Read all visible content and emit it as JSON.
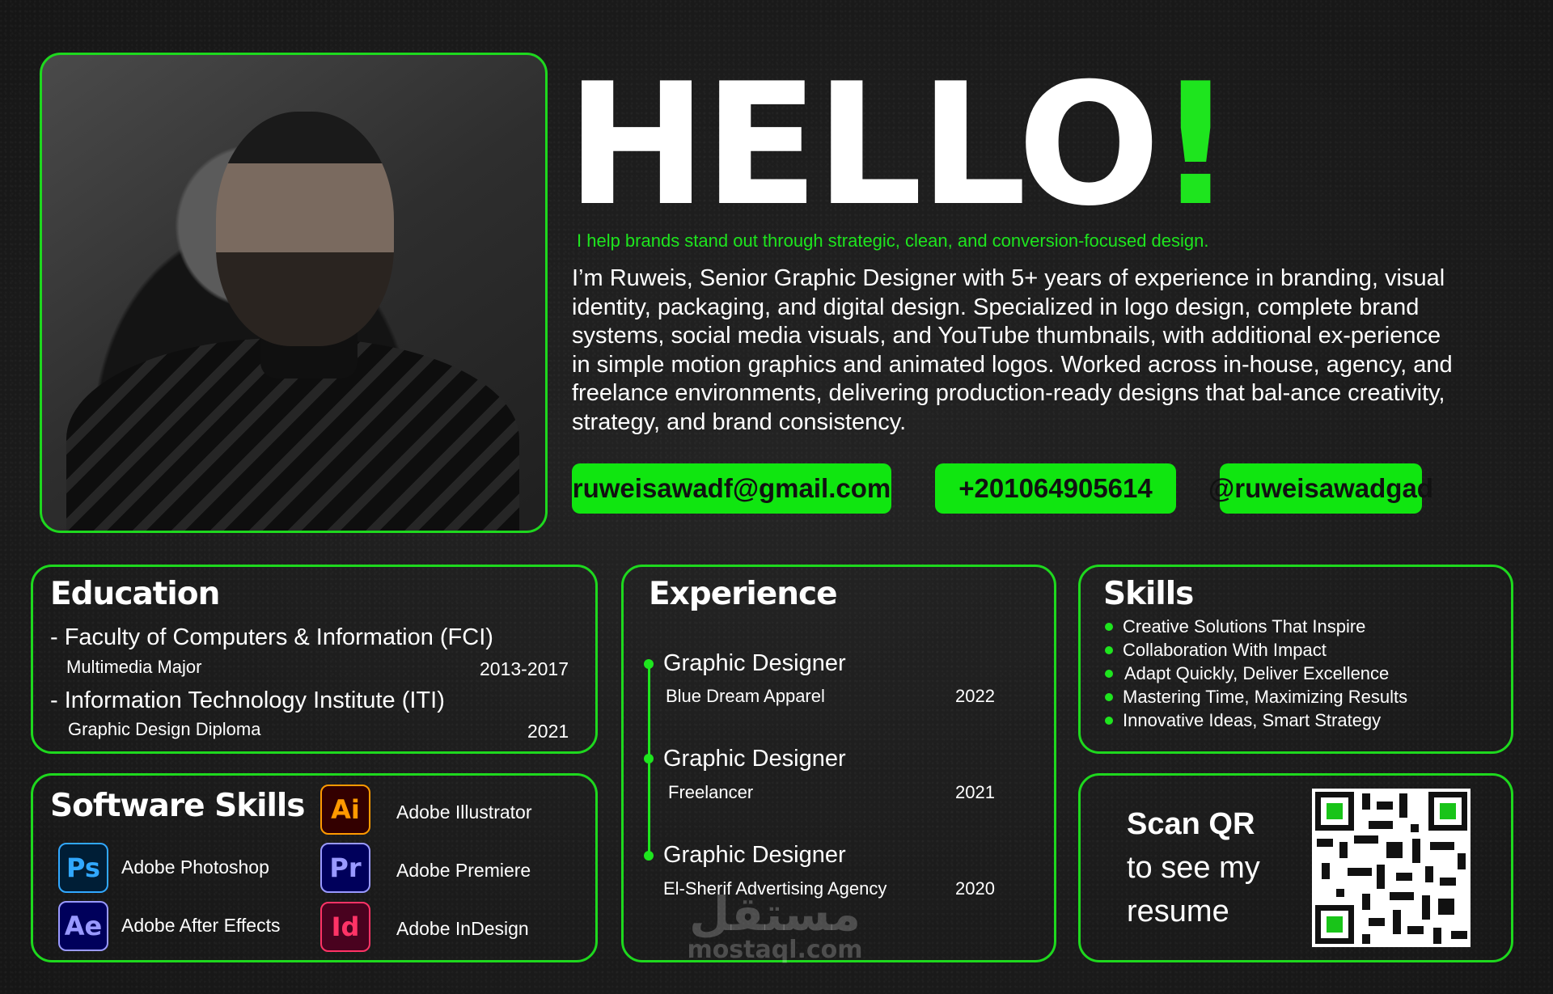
{
  "header": {
    "hello_word": "HELLO",
    "hello_mark": "!",
    "tagline": "I help brands stand out through strategic, clean, and conversion-focused design.",
    "bio": "I’m Ruweis, Senior Graphic Designer with 5+ years of experience in branding, visual identity, packaging, and digital design. Specialized in logo design, complete brand systems, social media visuals, and YouTube thumbnails, with additional ex-perience in simple motion graphics and animated logos. Worked across in-house, agency, and freelance environments, delivering production-ready designs that bal-ance creativity, strategy, and brand consistency."
  },
  "contacts": {
    "email": "ruweisawadf@gmail.com",
    "phone": "+201064905614",
    "handle": "@ruweisawadgad"
  },
  "education": {
    "title": "Education",
    "items": [
      {
        "school": "- Faculty of Computers & Information (FCI)",
        "detail": "Multimedia Major",
        "years": "2013-2017"
      },
      {
        "school": "- Information Technology Institute (ITI)",
        "detail": "Graphic Design Diploma",
        "years": "2021"
      }
    ]
  },
  "software": {
    "title": "Software Skills",
    "items": [
      {
        "abbr": "Ps",
        "name": "Adobe Photoshop",
        "icon": "photoshop-icon"
      },
      {
        "abbr": "Ae",
        "name": "Adobe After Effects",
        "icon": "after-effects-icon"
      },
      {
        "abbr": "Ai",
        "name": "Adobe Illustrator",
        "icon": "illustrator-icon"
      },
      {
        "abbr": "Pr",
        "name": "Adobe Premiere",
        "icon": "premiere-icon"
      },
      {
        "abbr": "Id",
        "name": "Adobe InDesign",
        "icon": "indesign-icon"
      }
    ]
  },
  "experience": {
    "title": "Experience",
    "items": [
      {
        "role": "Graphic Designer",
        "company": "Blue Dream Apparel",
        "year": "2022"
      },
      {
        "role": "Graphic Designer",
        "company": "Freelancer",
        "year": "2021"
      },
      {
        "role": "Graphic Designer",
        "company": "El-Sherif Advertising Agency",
        "year": "2020"
      }
    ]
  },
  "skills": {
    "title": "Skills",
    "items": [
      "Creative Solutions That Inspire",
      "Collaboration With Impact",
      "Adapt Quickly, Deliver Excellence",
      "Mastering Time, Maximizing Results",
      "Innovative Ideas, Smart Strategy"
    ]
  },
  "qr": {
    "line1": "Scan QR",
    "line2": "to see my",
    "line3": "resume"
  },
  "watermark": {
    "arabic": "مستقل",
    "latin": "mostaql.com"
  },
  "colors": {
    "accent": "#1ee51e",
    "background": "#1c1c1c",
    "photoshop": "#31a8ff",
    "after_effects": "#9999ff",
    "illustrator": "#ff9a00",
    "premiere": "#9999ff",
    "indesign": "#ff3366"
  }
}
